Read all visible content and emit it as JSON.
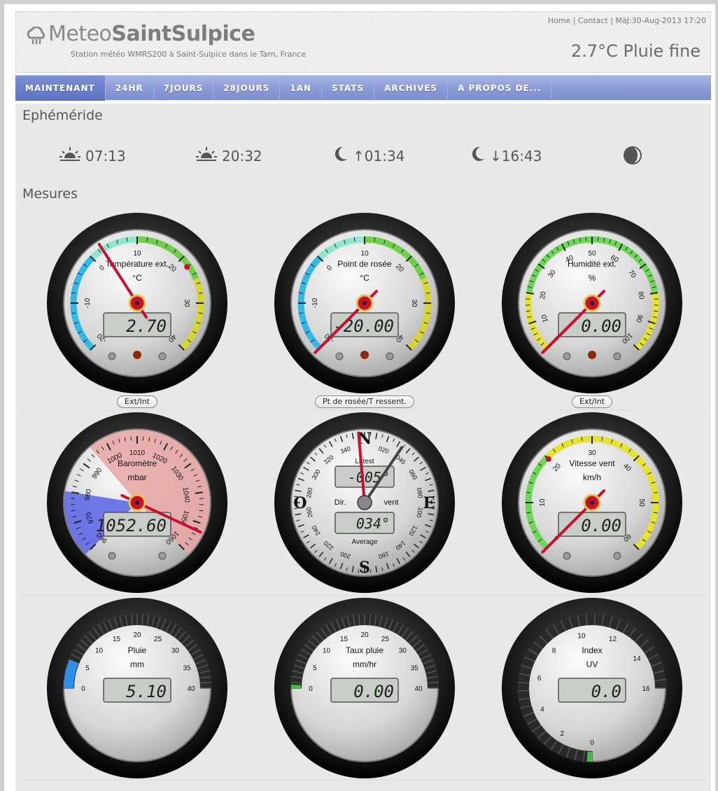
{
  "header": {
    "logo_part1": "Meteo",
    "logo_part2": "SaintSulpice",
    "tagline": "Station météo WMRS200 à Saint-Sulpice dans le Tarn, France",
    "links": {
      "home": "Home",
      "contact": "Contact",
      "updated": "MàJ:30-Aug-2013 17:20"
    },
    "current_conditions": "2.7°C Pluie fine"
  },
  "nav": {
    "items": [
      "MAINTENANT",
      "24HR",
      "7JOURS",
      "28JOURS",
      "1AN",
      "STATS",
      "ARCHIVES",
      "A PROPOS DE..."
    ],
    "active_index": 0,
    "active_color": "#5e71c4"
  },
  "ephemeride": {
    "title": "Ephéméride",
    "sunrise": "07:13",
    "sunset": "20:32",
    "moonrise": "↑01:34",
    "moonset": "↓16:43",
    "moon_phase_icon": "moon-phase-icon"
  },
  "mesures": {
    "title": "Mesures"
  },
  "gauges": {
    "temp": {
      "title": "Température ext.",
      "unit": "°C",
      "display": "2.70",
      "value": 2.7,
      "min": -20,
      "max": 40,
      "ticks": [
        "-20",
        "-10",
        "0",
        "10",
        "20",
        "30",
        "40"
      ],
      "bands": [
        {
          "from": -20,
          "to": 0,
          "color": "#35b8e8"
        },
        {
          "from": 0,
          "to": 10,
          "color": "#8fe6cf"
        },
        {
          "from": 10,
          "to": 25,
          "color": "#6fcf4b"
        },
        {
          "from": 25,
          "to": 40,
          "color": "#d8d530"
        }
      ],
      "button": "Ext/Int"
    },
    "dew": {
      "title": "Point de rosée",
      "unit": "°C",
      "display": "-20.00",
      "value": -20,
      "min": -20,
      "max": 40,
      "ticks": [
        "-20",
        "-10",
        "0",
        "10",
        "20",
        "30",
        "40"
      ],
      "bands": [
        {
          "from": -20,
          "to": 0,
          "color": "#35b8e8"
        },
        {
          "from": 0,
          "to": 10,
          "color": "#8fe6cf"
        },
        {
          "from": 10,
          "to": 25,
          "color": "#6fcf4b"
        },
        {
          "from": 25,
          "to": 40,
          "color": "#d8d530"
        }
      ],
      "button": "Pt de rosée/T ressent."
    },
    "humidity": {
      "title": "Humidité ext.",
      "unit": "%",
      "display": "0.00",
      "value": 0,
      "min": 0,
      "max": 100,
      "ticks": [
        "0",
        "10",
        "20",
        "30",
        "40",
        "50",
        "60",
        "70",
        "80",
        "90",
        "100"
      ],
      "bands": [
        {
          "from": 0,
          "to": 20,
          "color": "#e6e230"
        },
        {
          "from": 20,
          "to": 80,
          "color": "#6fd65a"
        },
        {
          "from": 80,
          "to": 100,
          "color": "#e6e230"
        }
      ],
      "button": "Ext/Int"
    },
    "baro": {
      "title": "Baromètre",
      "unit": "mbar",
      "display": "1052.60",
      "value": 1052.6,
      "min": 960,
      "max": 1060,
      "ticks": [
        "960",
        "970",
        "980",
        "990",
        "1000",
        "1010",
        "1020",
        "1030",
        "1040",
        "1050",
        "1060"
      ]
    },
    "wind_dir": {
      "latest_label": "Latest",
      "latest_display": "-005°",
      "latest_value": 355,
      "mid_label_left": "Dir.",
      "mid_label_right": "vent",
      "average_label": "Average",
      "average_display": "034°",
      "average_value": 34,
      "cardinals": {
        "n": "N",
        "e": "E",
        "s": "S",
        "w": "O"
      },
      "ticks": [
        "020",
        "040",
        "060",
        "080",
        "100",
        "120",
        "140",
        "160",
        "200",
        "220",
        "240",
        "260",
        "280",
        "300",
        "320",
        "340"
      ]
    },
    "wind_speed": {
      "title": "Vitesse vent",
      "unit": "km/h",
      "display": "0.00",
      "value": 0,
      "min": 0,
      "max": 60,
      "ticks": [
        "0",
        "10",
        "20",
        "30",
        "40",
        "50",
        "60"
      ],
      "bands": [
        {
          "from": 0,
          "to": 20,
          "color": "#6fd65a"
        },
        {
          "from": 20,
          "to": 60,
          "color": "#e6e230"
        }
      ]
    },
    "rain": {
      "title": "Pluie",
      "unit": "mm",
      "display": "5.10",
      "value": 5.1,
      "min": 0,
      "max": 40,
      "ticks": [
        "0",
        "5",
        "10",
        "15",
        "20",
        "25",
        "30",
        "35",
        "40"
      ],
      "fill_color": "#2f8fe6"
    },
    "rain_rate": {
      "title": "Taux pluie",
      "unit": "mm/hr",
      "display": "0.00",
      "value": 0,
      "min": 0,
      "max": 40,
      "ticks": [
        "0",
        "5",
        "10",
        "15",
        "20",
        "25",
        "30",
        "35",
        "40"
      ],
      "fill_color": "#40c040"
    },
    "uv": {
      "title": "Index",
      "unit": "UV",
      "display": "0.0",
      "value": 0,
      "min": 0,
      "max": 16,
      "ticks": [
        "0",
        "2",
        "4",
        "6",
        "8",
        "10",
        "12",
        "14",
        "16"
      ],
      "fill_color": "#40c040"
    }
  }
}
